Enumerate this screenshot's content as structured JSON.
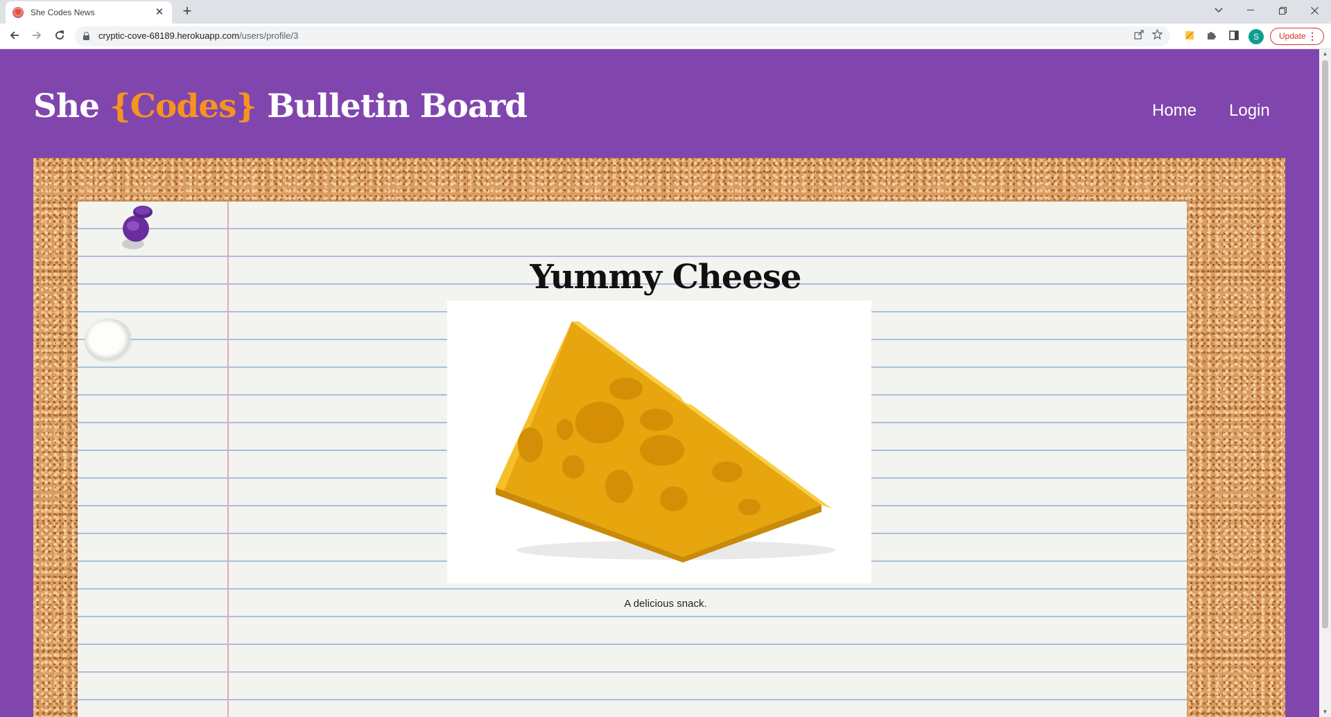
{
  "browser": {
    "tab_title": "She Codes News",
    "tab_close": "✕",
    "new_tab": "+",
    "url_host": "cryptic-cove-68189.herokuapp.com",
    "url_path": "/users/profile/3",
    "profile_initial": "S",
    "update_label": "Update",
    "update_menu": "⋮"
  },
  "site": {
    "title_part1": "She ",
    "title_codes": "{Codes}",
    "title_part2": " Bulletin Board",
    "nav": {
      "home": "Home",
      "login": "Login"
    }
  },
  "post": {
    "title": "Yummy Cheese",
    "caption": "A delicious snack.",
    "image_alt": "Wedge of yellow cheese with holes"
  },
  "colors": {
    "header_bg": "#8046ae",
    "brand_accent": "#f7931e",
    "cork": "#d99d62",
    "pin": "#6a2e9c"
  }
}
